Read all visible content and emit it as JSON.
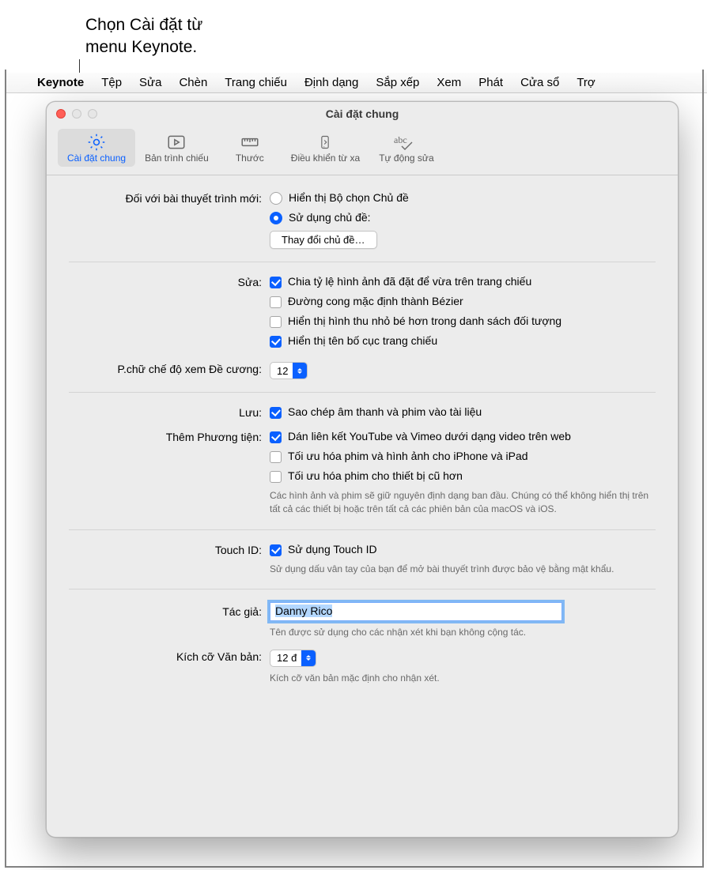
{
  "callout": "Chọn Cài đặt từ\nmenu Keynote.",
  "menubar": {
    "apple": "",
    "items": [
      "Keynote",
      "Tệp",
      "Sửa",
      "Chèn",
      "Trang chiếu",
      "Định dạng",
      "Sắp xếp",
      "Xem",
      "Phát",
      "Cửa sổ",
      "Trợ"
    ]
  },
  "window": {
    "title": "Cài đặt chung",
    "tabs": [
      {
        "label": "Cài đặt chung",
        "name": "general"
      },
      {
        "label": "Bản trình chiếu",
        "name": "slideshow"
      },
      {
        "label": "Thước",
        "name": "rulers"
      },
      {
        "label": "Điều khiển từ xa",
        "name": "remotes"
      },
      {
        "label": "Tự động sửa",
        "name": "autocorrect"
      }
    ]
  },
  "section_new": {
    "label": "Đối với bài thuyết trình mới:",
    "opt1": "Hiển thị Bộ chọn Chủ đề",
    "opt2": "Sử dụng chủ đề:",
    "button": "Thay đổi chủ đề…"
  },
  "section_edit": {
    "label": "Sửa:",
    "c1": "Chia tỷ lệ hình ảnh đã đặt để vừa trên trang chiếu",
    "c2": "Đường cong mặc định thành Bézier",
    "c3": "Hiển thị hình thu nhỏ bé hơn trong danh sách đối tượng",
    "c4": "Hiển thị tên bố cục trang chiếu"
  },
  "section_outline": {
    "label": "P.chữ chế độ xem Đề cương:",
    "value": "12"
  },
  "section_save": {
    "label": "Lưu:",
    "c1": "Sao chép âm thanh và phim vào tài liệu"
  },
  "section_media": {
    "label": "Thêm Phương tiện:",
    "c1": "Dán liên kết YouTube và Vimeo dưới dạng video trên web",
    "c2": "Tối ưu hóa phim và hình ảnh cho iPhone và iPad",
    "c3": "Tối ưu hóa phim cho thiết bị cũ hơn",
    "hint": "Các hình ảnh và phim sẽ giữ nguyên định dạng ban đầu. Chúng có thể không hiển thị trên tất cả các thiết bị hoặc trên tất cả các phiên bản của macOS và iOS."
  },
  "section_touch": {
    "label": "Touch ID:",
    "c1": "Sử dụng Touch ID",
    "hint": "Sử dụng dấu vân tay của bạn để mở bài thuyết trình được bảo vệ bằng mật khẩu."
  },
  "section_author": {
    "label": "Tác giả:",
    "value": "Danny Rico",
    "hint": "Tên được sử dụng cho các nhận xét khi bạn không cộng tác."
  },
  "section_textsize": {
    "label": "Kích cỡ Văn bản:",
    "value": "12 đ",
    "hint": "Kích cỡ văn bản mặc định cho nhận xét."
  }
}
